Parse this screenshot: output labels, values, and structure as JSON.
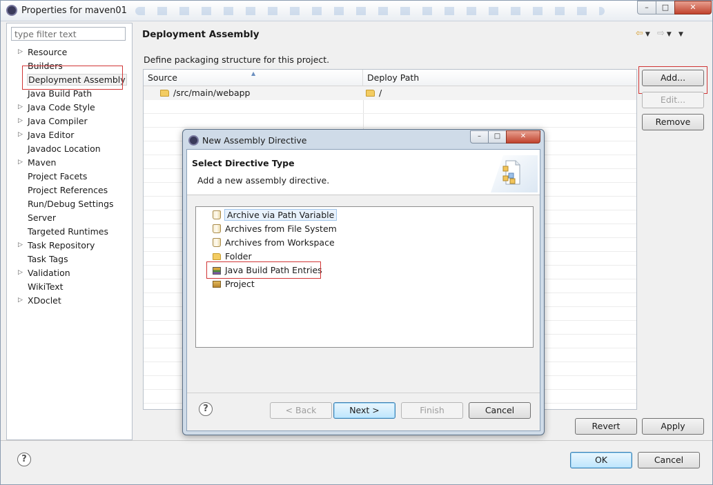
{
  "window": {
    "title": "Properties for maven01"
  },
  "filter": {
    "placeholder": "type filter text"
  },
  "nav": {
    "items": [
      {
        "label": "Resource",
        "expandable": true
      },
      {
        "label": "Builders",
        "expandable": false
      },
      {
        "label": "Deployment Assembly",
        "expandable": false,
        "selected": true
      },
      {
        "label": "Java Build Path",
        "expandable": false
      },
      {
        "label": "Java Code Style",
        "expandable": true
      },
      {
        "label": "Java Compiler",
        "expandable": true
      },
      {
        "label": "Java Editor",
        "expandable": true
      },
      {
        "label": "Javadoc Location",
        "expandable": false
      },
      {
        "label": "Maven",
        "expandable": true
      },
      {
        "label": "Project Facets",
        "expandable": false
      },
      {
        "label": "Project References",
        "expandable": false
      },
      {
        "label": "Run/Debug Settings",
        "expandable": false
      },
      {
        "label": "Server",
        "expandable": false
      },
      {
        "label": "Targeted Runtimes",
        "expandable": false
      },
      {
        "label": "Task Repository",
        "expandable": true
      },
      {
        "label": "Task Tags",
        "expandable": false
      },
      {
        "label": "Validation",
        "expandable": true
      },
      {
        "label": "WikiText",
        "expandable": false
      },
      {
        "label": "XDoclet",
        "expandable": true
      }
    ]
  },
  "page": {
    "title": "Deployment Assembly",
    "description": "Define packaging structure for this project.",
    "table": {
      "columns": [
        "Source",
        "Deploy Path"
      ],
      "rows": [
        {
          "source": "/src/main/webapp",
          "deploy_path": "/"
        }
      ]
    },
    "buttons": {
      "add": "Add...",
      "edit": "Edit...",
      "remove": "Remove",
      "revert": "Revert",
      "apply": "Apply"
    }
  },
  "footer": {
    "ok": "OK",
    "cancel": "Cancel",
    "help": "?"
  },
  "dialog": {
    "title": "New Assembly Directive",
    "banner_title": "Select Directive Type",
    "banner_subtitle": "Add a new assembly directive.",
    "items": [
      {
        "label": "Archive via Path Variable",
        "icon": "jar-icon",
        "selected": true
      },
      {
        "label": "Archives from File System",
        "icon": "jar-icon"
      },
      {
        "label": "Archives from Workspace",
        "icon": "jar-icon"
      },
      {
        "label": "Folder",
        "icon": "folder-icon"
      },
      {
        "label": "Java Build Path Entries",
        "icon": "library-icon",
        "highlighted": true
      },
      {
        "label": "Project",
        "icon": "project-icon"
      }
    ],
    "buttons": {
      "back": "< Back",
      "next": "Next >",
      "finish": "Finish",
      "cancel": "Cancel",
      "help": "?"
    }
  },
  "colors": {
    "highlight_box": "#d03434",
    "default_button": "#3c7fb1",
    "selection": "#e8f2fc"
  }
}
